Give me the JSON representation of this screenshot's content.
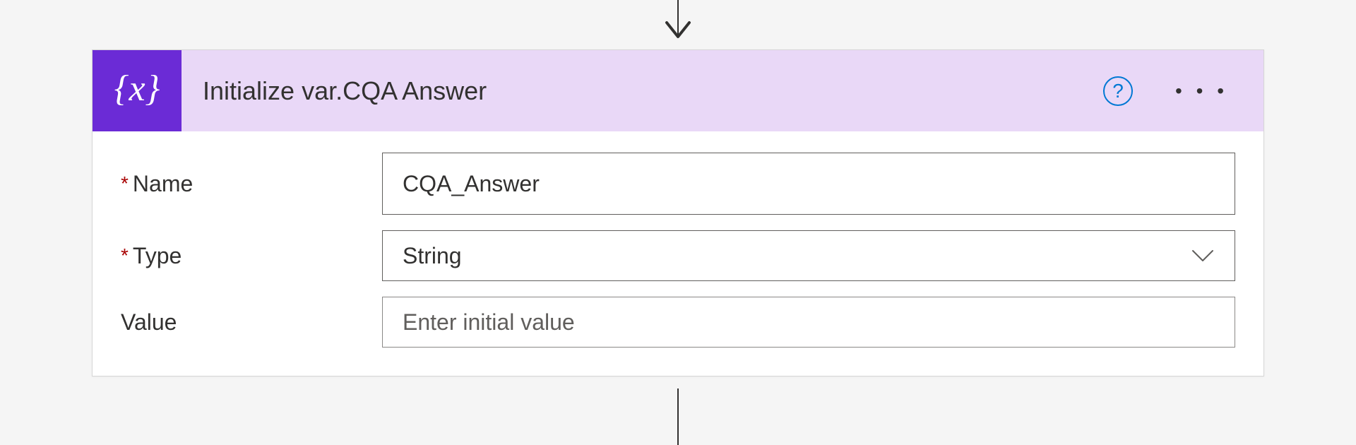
{
  "action": {
    "title": "Initialize var.CQA Answer",
    "icon": "variables-icon"
  },
  "fields": {
    "name": {
      "label": "Name",
      "required": true,
      "value": "CQA_Answer"
    },
    "type": {
      "label": "Type",
      "required": true,
      "selected": "String"
    },
    "value": {
      "label": "Value",
      "required": false,
      "value": "",
      "placeholder": "Enter initial value"
    }
  },
  "ui": {
    "help_tooltip": "?",
    "more_menu": "• • •"
  }
}
